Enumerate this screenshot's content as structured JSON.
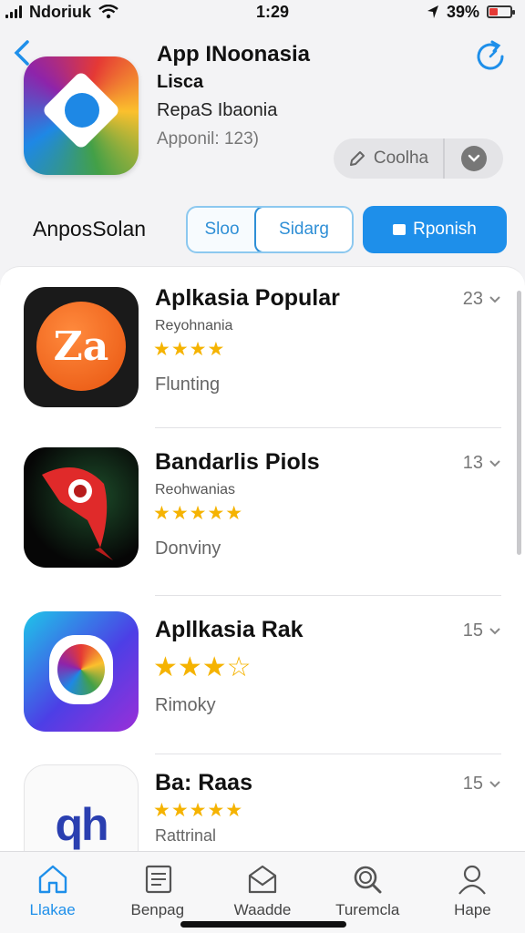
{
  "status_bar": {
    "carrier": "Ndoriuk",
    "time": "1:29",
    "battery_text": "39%",
    "battery_level": 0.39
  },
  "header": {
    "title": "App INoonasia",
    "subtitle": "Lisca",
    "developer": "RepaS Ibaonia",
    "version": "Apponil: 123)",
    "action_label": "Coolha"
  },
  "controls": {
    "section_label": "AnposSolan",
    "segments": [
      "Sloo",
      "Sidarg"
    ],
    "primary_button": "Rponish"
  },
  "apps": [
    {
      "name": "Aplkasia Popular",
      "sub": "Reyohnania",
      "rating": 3.5,
      "stars": "★★★★",
      "status": "Flunting",
      "count": "23"
    },
    {
      "name": "Bandarlis Piols",
      "sub": "Reohwanias",
      "rating": 4.5,
      "stars": "★★★★★",
      "status": "Donviny",
      "count": "13"
    },
    {
      "name": "Apllkasia Rak",
      "sub": "",
      "rating": 3.5,
      "stars": "★★★☆",
      "status": "Rimoky",
      "count": "15"
    },
    {
      "name": "Ba: Raas",
      "sub": "",
      "rating": 4.5,
      "stars": "★★★★★",
      "status": "Rattrinal",
      "count": "15"
    }
  ],
  "icon_text": {
    "za": "Za",
    "qh": "qh"
  },
  "tabs": [
    {
      "label": "Llakae",
      "icon": "home-icon",
      "active": true
    },
    {
      "label": "Benpag",
      "icon": "document-icon",
      "active": false
    },
    {
      "label": "Waadde",
      "icon": "mail-icon",
      "active": false
    },
    {
      "label": "Turemcla",
      "icon": "search-icon",
      "active": false
    },
    {
      "label": "Hape",
      "icon": "person-icon",
      "active": false
    }
  ],
  "colors": {
    "accent": "#1e8fea",
    "star": "#f5b301",
    "battery": "#e53935"
  }
}
